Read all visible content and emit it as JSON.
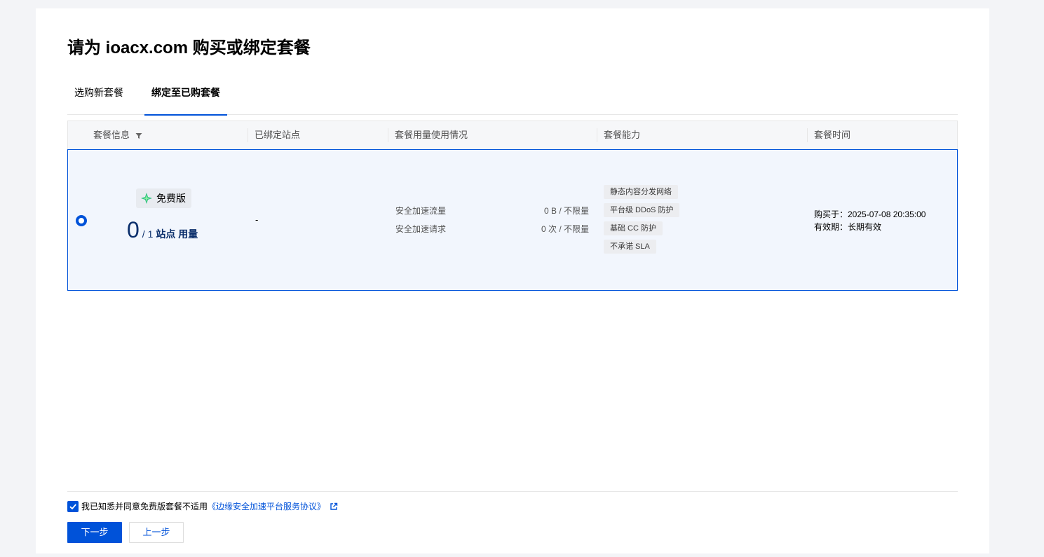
{
  "page": {
    "title": "请为 ioacx.com 购买或绑定套餐"
  },
  "tabs": [
    {
      "label": "选购新套餐",
      "active": false
    },
    {
      "label": "绑定至已购套餐",
      "active": true
    }
  ],
  "table": {
    "columns": [
      "套餐信息",
      "已绑定站点",
      "套餐用量使用情况",
      "套餐能力",
      "套餐时间"
    ],
    "rows": [
      {
        "selected": true,
        "plan_name": "免费版",
        "usage_used": "0",
        "usage_total": "/ 1",
        "usage_unit": "站点 用量",
        "bound_sites": "-",
        "quotas": [
          {
            "label": "安全加速流量",
            "value": "0 B / 不限量"
          },
          {
            "label": "安全加速请求",
            "value": "0 次 / 不限量"
          }
        ],
        "capabilities": [
          "静态内容分发网络",
          "平台级 DDoS 防护",
          "基础 CC 防护",
          "不承诺 SLA"
        ],
        "purchased_at": "购买于：2025-07-08 20:35:00",
        "validity": "有效期：长期有效"
      }
    ]
  },
  "agreement": {
    "checked": true,
    "text": "我已知悉并同意免费版套餐不适用",
    "link": "《边缘安全加速平台服务协议》"
  },
  "buttons": {
    "next": "下一步",
    "prev": "上一步"
  },
  "colors": {
    "primary": "#0052d9",
    "selected_row_bg": "#f2f6fd"
  }
}
